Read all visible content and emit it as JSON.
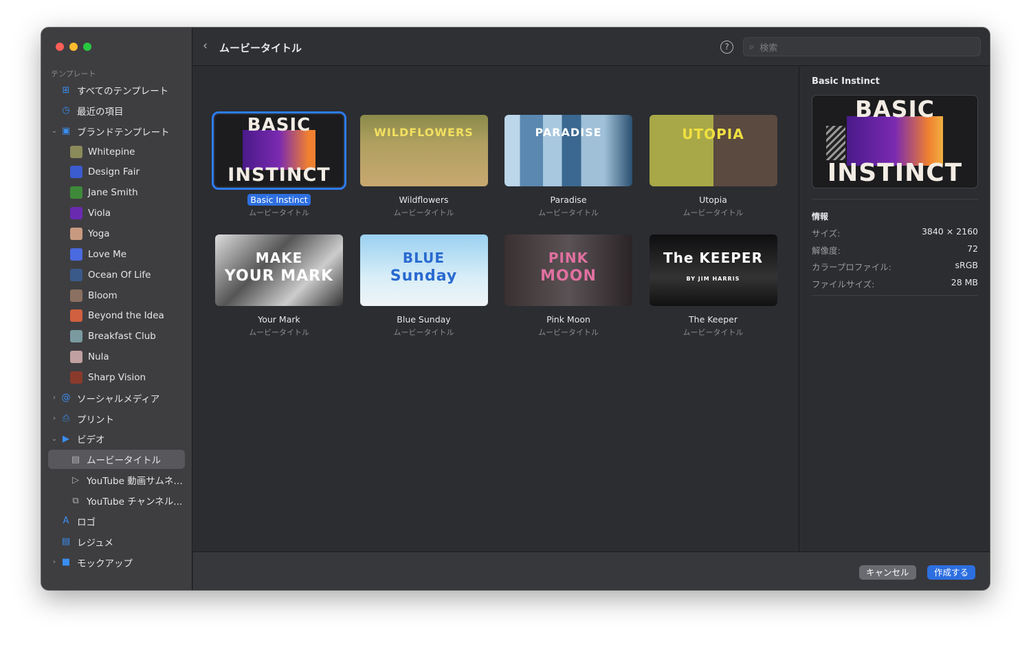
{
  "window": {
    "traffic_lights": [
      "#fe5f57",
      "#febc2e",
      "#28c840"
    ]
  },
  "sidebar": {
    "section": "テンプレート",
    "items": [
      {
        "label": "すべてのテンプレート",
        "icon": "grid-icon"
      },
      {
        "label": "最近の項目",
        "icon": "clock-icon"
      },
      {
        "label": "ブランドテンプレート",
        "icon": "brand-icon",
        "expanded": true
      },
      {
        "label": "Whitepine",
        "color": "#8a8a5a"
      },
      {
        "label": "Design Fair",
        "color": "#3b5bd0"
      },
      {
        "label": "Jane Smith",
        "color": "#3e8a3a"
      },
      {
        "label": "Viola",
        "color": "#6a2ab0"
      },
      {
        "label": "Yoga",
        "color": "#c89a80"
      },
      {
        "label": "Love Me",
        "color": "#4a6ae0"
      },
      {
        "label": "Ocean Of Life",
        "color": "#3a5a8a"
      },
      {
        "label": "Bloom",
        "color": "#8a7060"
      },
      {
        "label": "Beyond the Idea",
        "color": "#d06040"
      },
      {
        "label": "Breakfast Club",
        "color": "#7a9aa0"
      },
      {
        "label": "Nula",
        "color": "#c0a0a0"
      },
      {
        "label": "Sharp Vision",
        "color": "#8a3a2a"
      },
      {
        "label": "ソーシャルメディア",
        "icon": "at-icon",
        "expanded": false
      },
      {
        "label": "プリント",
        "icon": "printer-icon",
        "expanded": false
      },
      {
        "label": "ビデオ",
        "icon": "video-icon",
        "expanded": true
      },
      {
        "label": "ムービータイトル",
        "icon": "film-icon",
        "selected": true
      },
      {
        "label": "YouTube 動画サムネ…",
        "icon": "play-icon"
      },
      {
        "label": "YouTube チャンネル...",
        "icon": "play-stack-icon"
      },
      {
        "label": "ロゴ",
        "icon": "logo-a-icon"
      },
      {
        "label": "レジュメ",
        "icon": "document-icon"
      },
      {
        "label": "モックアップ",
        "icon": "mockup-icon",
        "expanded": false
      }
    ]
  },
  "header": {
    "title": "ムービータイトル",
    "help": "?",
    "search_placeholder": "検索"
  },
  "templates": [
    {
      "name": "Basic Instinct",
      "sub": "ムービータイトル",
      "poster": [
        "BASIC",
        "INSTINCT"
      ],
      "selected": true
    },
    {
      "name": "Wildflowers",
      "sub": "ムービータイトル",
      "poster": [
        "WILDFLOWERS",
        ""
      ]
    },
    {
      "name": "Paradise",
      "sub": "ムービータイトル",
      "poster": [
        "PARADISE",
        ""
      ]
    },
    {
      "name": "Utopia",
      "sub": "ムービータイトル",
      "poster": [
        "UTOPIA",
        ""
      ]
    },
    {
      "name": "Your Mark",
      "sub": "ムービータイトル",
      "poster": [
        "MAKE",
        "YOUR MARK"
      ]
    },
    {
      "name": "Blue Sunday",
      "sub": "ムービータイトル",
      "poster": [
        "BLUE",
        "Sunday"
      ]
    },
    {
      "name": "Pink Moon",
      "sub": "ムービータイトル",
      "poster": [
        "PINK",
        "MOON"
      ]
    },
    {
      "name": "The Keeper",
      "sub": "ムービータイトル",
      "poster": [
        "The KEEPER",
        "BY JIM HARRIS"
      ]
    }
  ],
  "details": {
    "title": "Basic Instinct",
    "preview": [
      "BASIC",
      "INSTINCT"
    ],
    "info_heading": "情報",
    "rows": [
      {
        "k": "サイズ:",
        "v": "3840 × 2160"
      },
      {
        "k": "解像度:",
        "v": "72"
      },
      {
        "k": "カラープロファイル:",
        "v": "sRGB"
      },
      {
        "k": "ファイルサイズ:",
        "v": "28 MB"
      }
    ]
  },
  "footer": {
    "cancel": "キャンセル",
    "create": "作成する"
  },
  "colors": {
    "accent": "#2d6fe0"
  }
}
